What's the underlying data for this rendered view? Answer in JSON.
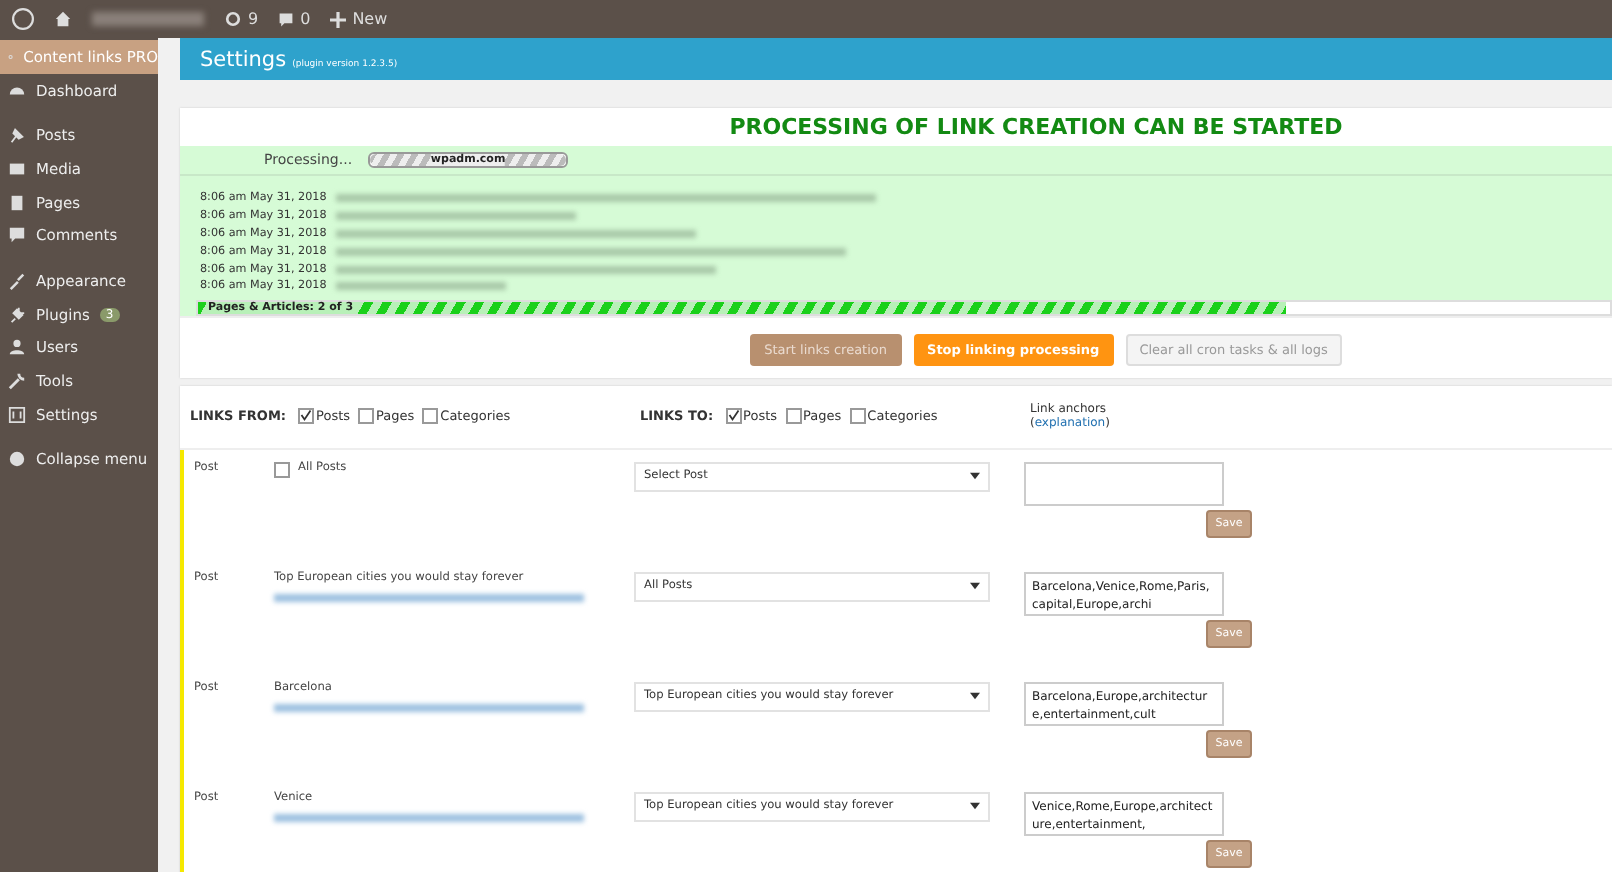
{
  "admin_bar": {
    "updates": "9",
    "comments": "0",
    "new_label": "New"
  },
  "sidebar": {
    "items": [
      {
        "label": "Content links PRO",
        "selected": true
      },
      {
        "label": "Dashboard",
        "selected": false
      },
      {
        "label": "Posts",
        "selected": false
      },
      {
        "label": "Media",
        "selected": false
      },
      {
        "label": "Pages",
        "selected": false
      },
      {
        "label": "Comments",
        "selected": false
      },
      {
        "label": "Appearance",
        "selected": false
      },
      {
        "label": "Plugins",
        "badge": "3",
        "selected": false
      },
      {
        "label": "Users",
        "selected": false
      },
      {
        "label": "Tools",
        "selected": false
      },
      {
        "label": "Settings",
        "selected": false
      },
      {
        "label": "Collapse menu",
        "selected": false
      }
    ]
  },
  "header": {
    "title": "Settings",
    "version": "(plugin version 1.2.3.5)"
  },
  "process": {
    "title": "PROCESSING OF LINK CREATION CAN BE STARTED",
    "status": "Processing...",
    "mini_bar_label": "wpadm.com",
    "mini_bar": {
      "level": 1
    },
    "log": [
      "8:06 am May 31, 2018",
      "8:06 am May 31, 2018",
      "8:06 am May 31, 2018",
      "8:06 am May 31, 2018",
      "8:06 am May 31, 2018",
      "8:06 am May 31, 2018"
    ],
    "progress": {
      "label": "Pages & Articles: 2 of 3",
      "level": 0.77
    },
    "buttons": [
      {
        "label": "Start links creation",
        "kind": "muted"
      },
      {
        "label": "Stop linking processing",
        "kind": "primary"
      },
      {
        "label": "Clear all cron tasks & all logs",
        "kind": "secondary"
      }
    ]
  },
  "links_from": {
    "label": "LINKS FROM:",
    "options": [
      {
        "label": "Posts",
        "checked": true
      },
      {
        "label": "Pages",
        "checked": false
      },
      {
        "label": "Categories",
        "checked": false
      }
    ]
  },
  "links_to": {
    "label": "LINKS TO:",
    "options": [
      {
        "label": "Posts",
        "checked": true
      },
      {
        "label": "Pages",
        "checked": false
      },
      {
        "label": "Categories",
        "checked": false
      }
    ]
  },
  "anchors_header": {
    "title": "Link anchors",
    "open": "(",
    "link": "explanation",
    "close": ")"
  },
  "rows": [
    {
      "kind": "all",
      "type": "Post",
      "all_label": "All Posts",
      "checked": false,
      "target": "Select Post",
      "save": "Save"
    },
    {
      "kind": "post",
      "type": "Post",
      "title": "Top European cities you would stay forever",
      "target": "All Posts",
      "anchors": "Barcelona,Venice,Rome,Paris,capital,Europe,archi",
      "save": "Save"
    },
    {
      "kind": "post",
      "type": "Post",
      "title": "Barcelona",
      "target": "Top European cities you would stay forever",
      "anchors": "Barcelona,Europe,architecture,entertainment,cult",
      "save": "Save"
    },
    {
      "kind": "post",
      "type": "Post",
      "title": "Venice",
      "target": "Top European cities you would stay forever",
      "anchors": "Venice,Rome,Europe,architecture,entertainment,",
      "save": "Save"
    }
  ]
}
